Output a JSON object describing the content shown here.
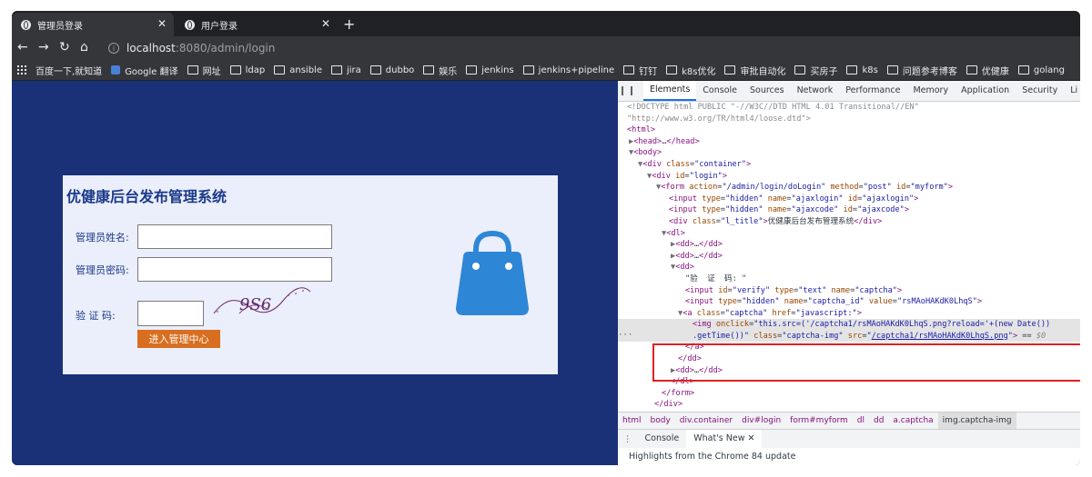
{
  "browser": {
    "tabs": [
      {
        "title": "管理员登录",
        "active": true
      },
      {
        "title": "用户登录",
        "active": false
      }
    ],
    "url_host": "localhost",
    "url_path": ":8080/admin/login",
    "bookmarks": [
      "百度一下,就知道",
      "Google 翻译",
      "网址",
      "ldap",
      "ansible",
      "jira",
      "dubbo",
      "娱乐",
      "jenkins",
      "jenkins+pipeline",
      "钉钉",
      "k8s优化",
      "审批自动化",
      "买房子",
      "k8s",
      "问题参考博客",
      "优健康",
      "golang"
    ]
  },
  "login": {
    "title": "优健康后台发布管理系统",
    "username_label": "管理员姓名:",
    "password_label": "管理员密码:",
    "captcha_label": "验 证 码:",
    "submit_label": "进入管理中心",
    "captcha_text": "9S6"
  },
  "devtools": {
    "tabs": [
      "Elements",
      "Console",
      "Sources",
      "Network",
      "Performance",
      "Memory",
      "Application",
      "Security",
      "Li"
    ],
    "breadcrumbs": [
      "html",
      "body",
      "div.container",
      "div#login",
      "form#myform",
      "dl",
      "dd",
      "a.captcha",
      "img.captcha-img"
    ],
    "drawer_tabs": [
      "Console",
      "What's New"
    ],
    "drawer_message": "Highlights from the Chrome 84 update"
  },
  "colors": {
    "page_bg": "#1a3178",
    "panel_bg": "#ebeefb",
    "button": "#d86e1f",
    "bag": "#2e86d6",
    "highlight_border": "#e02020"
  }
}
